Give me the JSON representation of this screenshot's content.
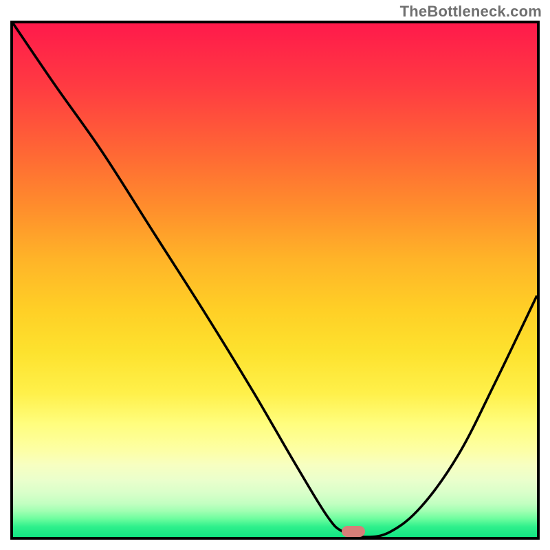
{
  "watermark": "TheBottleneck.com",
  "chart_data": {
    "type": "line",
    "title": "",
    "xlabel": "",
    "ylabel": "",
    "xlim": [
      0,
      100
    ],
    "ylim": [
      0,
      100
    ],
    "background": "red-to-green vertical gradient",
    "series": [
      {
        "name": "bottleneck-curve",
        "x": [
          0,
          8,
          17,
          27,
          37,
          46,
          54,
          60,
          63,
          67,
          72,
          78,
          85,
          92,
          100
        ],
        "y": [
          100,
          88,
          75,
          59,
          43,
          28,
          14,
          4,
          1,
          0,
          1,
          6,
          16,
          30,
          47
        ],
        "color": "#000000"
      }
    ],
    "marker": {
      "name": "optimal-point",
      "x": 65,
      "y": 0,
      "color": "#d67f79"
    },
    "gradient_stops": [
      {
        "pos": 0,
        "color": "#ff1a4b"
      },
      {
        "pos": 50,
        "color": "#ffc027"
      },
      {
        "pos": 80,
        "color": "#fcff90"
      },
      {
        "pos": 100,
        "color": "#12e583"
      }
    ]
  }
}
